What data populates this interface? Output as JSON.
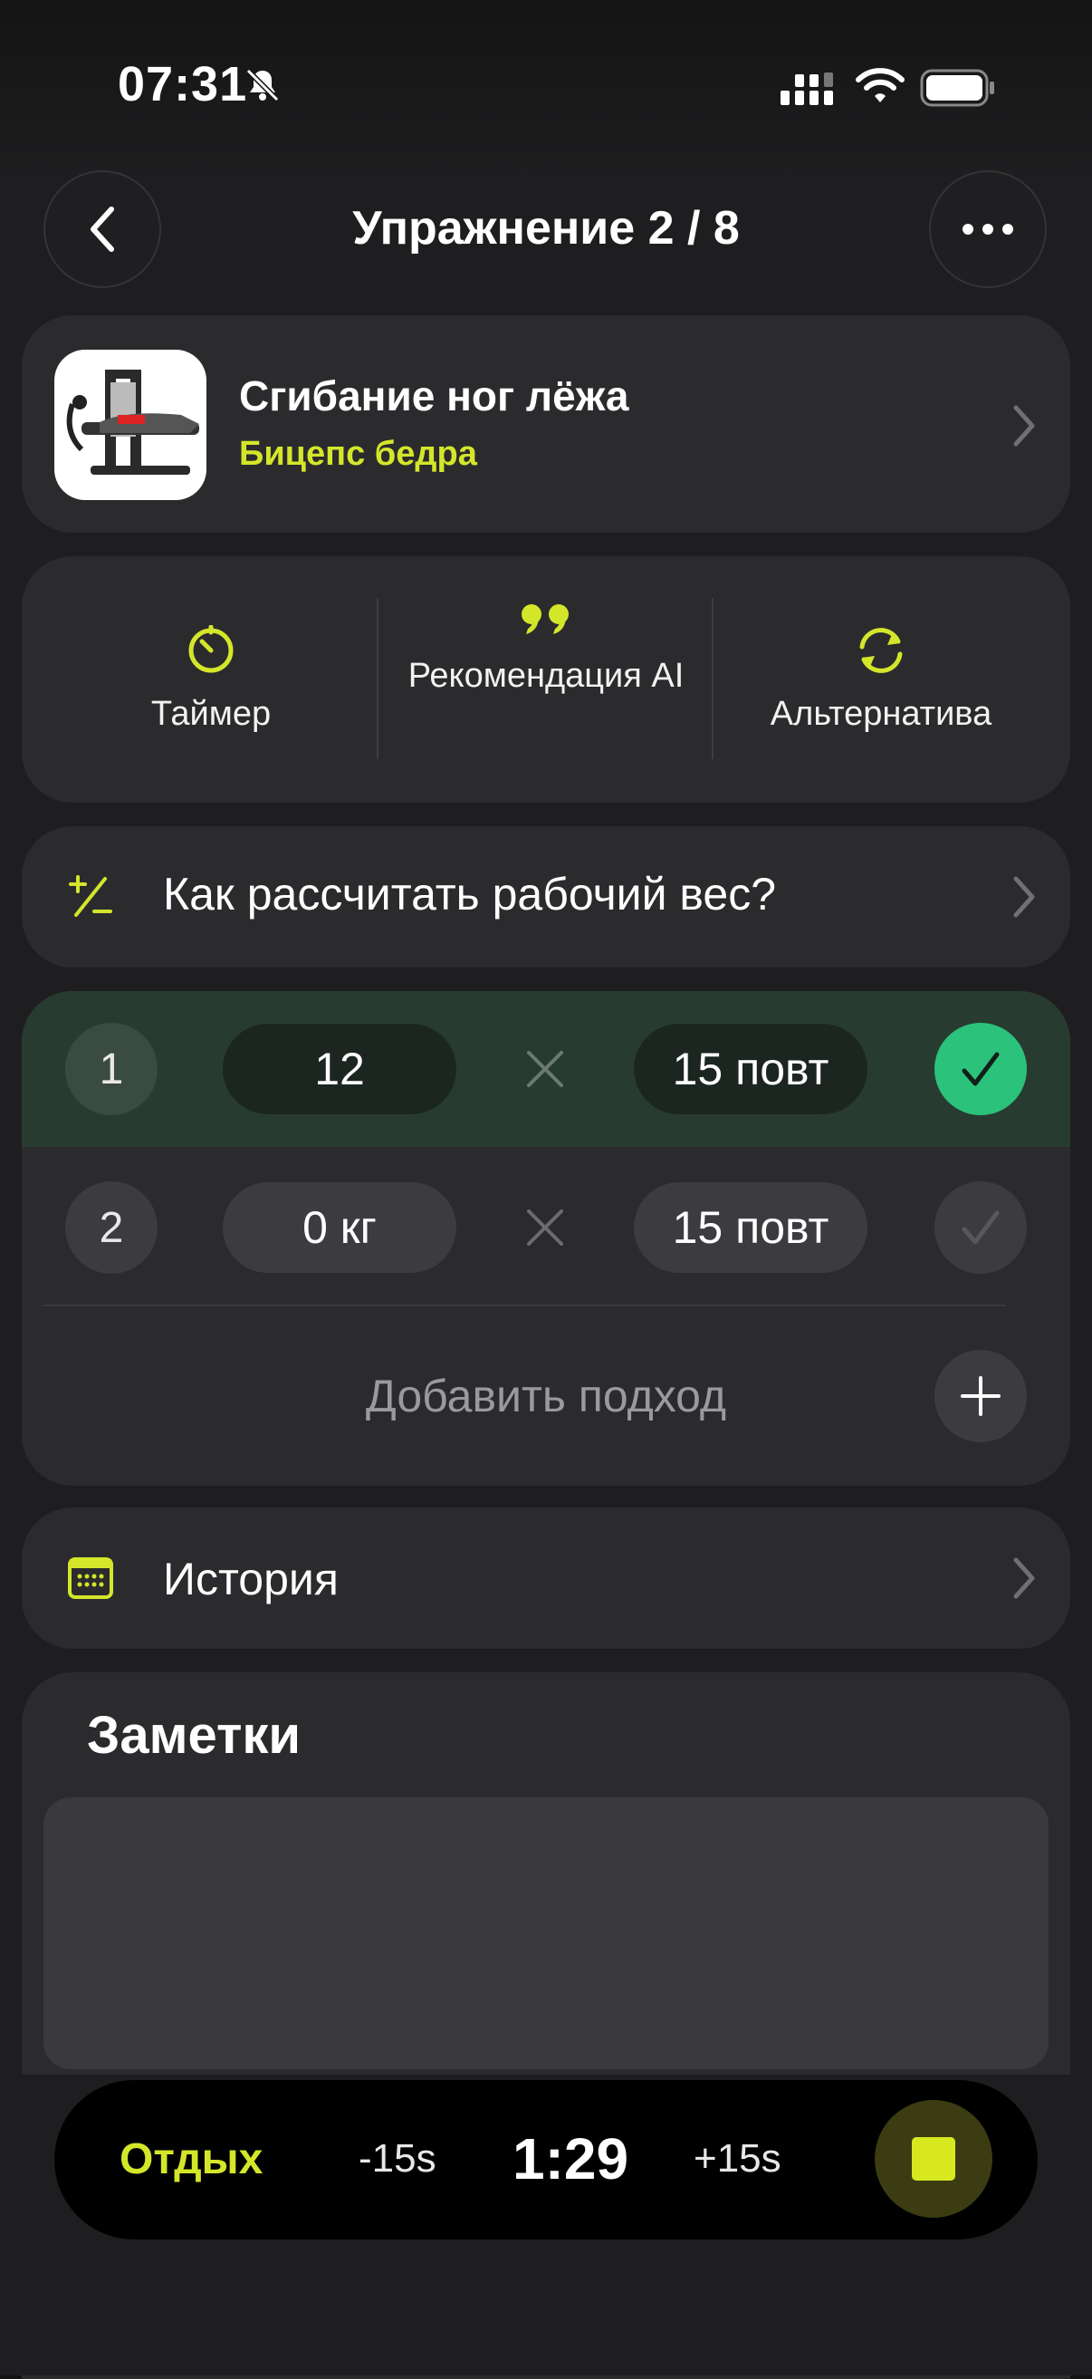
{
  "status_bar": {
    "time": "07:31"
  },
  "header": {
    "title": "Упражнение 2 / 8"
  },
  "exercise": {
    "name": "Сгибание ног лёжа",
    "muscle": "Бицепс бедра"
  },
  "actions": [
    {
      "label": "Таймер",
      "icon": "timer-icon"
    },
    {
      "label": "Рекомендация AI",
      "icon": "quote-icon"
    },
    {
      "label": "Альтернатива",
      "icon": "refresh-icon"
    }
  ],
  "calc": {
    "label": "Как рассчитать рабочий вес?"
  },
  "sets": [
    {
      "num": "1",
      "weight": "12",
      "reps": "15 повт",
      "done": true
    },
    {
      "num": "2",
      "weight": "0 кг",
      "reps": "15 повт",
      "done": false
    }
  ],
  "add_set": {
    "label": "Добавить подход"
  },
  "history": {
    "label": "История"
  },
  "notes": {
    "title": "Заметки",
    "value": ""
  },
  "rest": {
    "label": "Отдых",
    "minus": "-15s",
    "timer": "1:29",
    "plus": "+15s"
  },
  "colors": {
    "accent": "#d4e62a",
    "done": "#2bc27c",
    "card": "#2b2b2e"
  }
}
